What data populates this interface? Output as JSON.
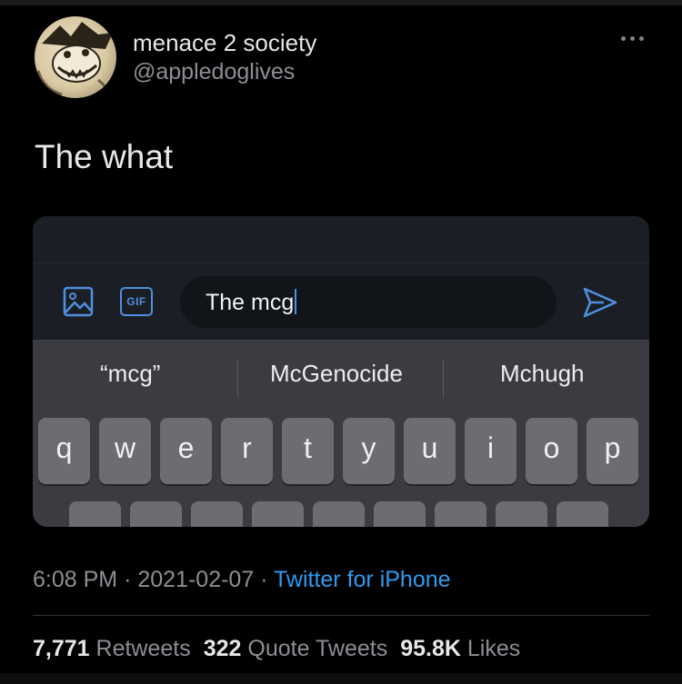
{
  "author": {
    "display_name": "menace 2 society",
    "handle": "@appledoglives"
  },
  "tweet": {
    "text": "The what"
  },
  "embedded_screenshot": {
    "compose_text": "The mcg",
    "gif_label": "GIF",
    "suggestions": [
      "“mcg”",
      "McGenocide",
      "Mchugh"
    ],
    "keys_row1": [
      "q",
      "w",
      "e",
      "r",
      "t",
      "y",
      "u",
      "i",
      "o",
      "p"
    ]
  },
  "meta": {
    "time": "6:08 PM",
    "date": "2021-02-07",
    "source": "Twitter for iPhone"
  },
  "stats": {
    "retweets_count": "7,771",
    "retweets_label": "Retweets",
    "quotes_count": "322",
    "quotes_label": "Quote Tweets",
    "likes_count": "95.8K",
    "likes_label": "Likes"
  },
  "colors": {
    "accent": "#2f9bf0",
    "background": "#000000",
    "keyboard": "#3a3c42",
    "key": "#6b6d73"
  }
}
